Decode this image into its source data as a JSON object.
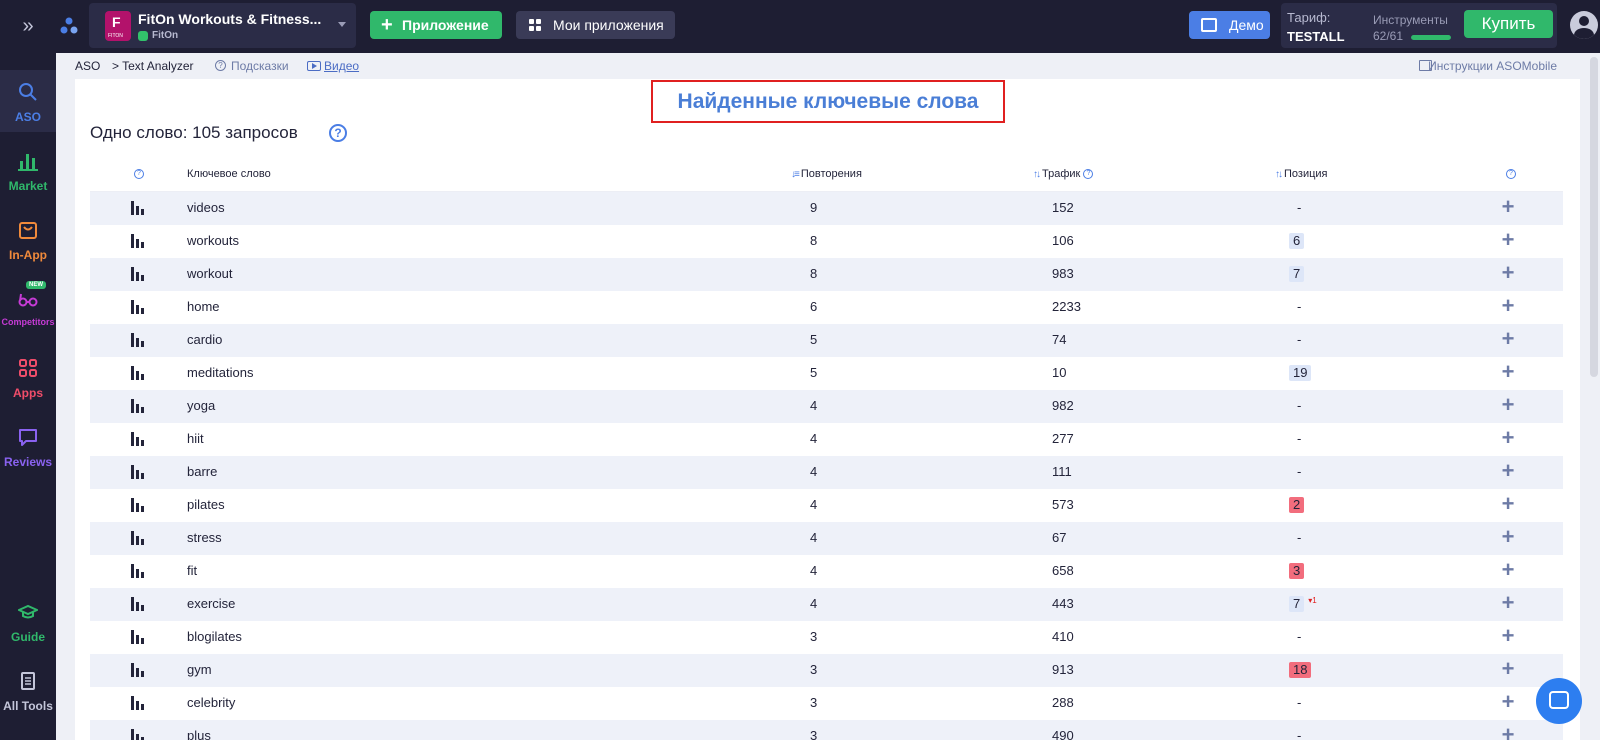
{
  "topbar": {
    "app_title": "FitOn Workouts & Fitness...",
    "app_developer": "FitOn",
    "app_icon_text": "F",
    "app_icon_sub": "FITON",
    "add_app_label": "Приложение",
    "my_apps_label": "Мои приложения",
    "demo_label": "Демо",
    "tariff_label": "Тариф:",
    "tariff_value": "TESTALL",
    "tools_label": "Инструменты",
    "tools_count": "62/61",
    "tools_progress_fraction": 1.0,
    "buy_label": "Купить"
  },
  "sidebar": {
    "items": [
      {
        "label": "ASO",
        "color": "#4b7ee5",
        "icon": "search-icon"
      },
      {
        "label": "Market",
        "color": "#30b86b",
        "icon": "bar-chart-icon"
      },
      {
        "label": "In-App",
        "color": "#f08a3b",
        "icon": "shopping-bag-icon"
      },
      {
        "label": "Competitors",
        "color": "#c63bd6",
        "icon": "glasses-icon",
        "badge": "NEW"
      },
      {
        "label": "Apps",
        "color": "#f04d6a",
        "icon": "apps-grid-icon"
      },
      {
        "label": "Reviews",
        "color": "#8a62f0",
        "icon": "chat-bubble-icon"
      },
      {
        "label": "Guide",
        "color": "#30b86b",
        "icon": "graduation-cap-icon"
      },
      {
        "label": "All Tools",
        "color": "#c4c6da",
        "icon": "document-icon"
      }
    ]
  },
  "breadcrumb": {
    "root": "ASO",
    "current": "> Text Analyzer",
    "hints": "Подсказки",
    "video": "Видео",
    "instructions": "Инструкции ASOMobile"
  },
  "main": {
    "found_title": "Найденные ключевые слова",
    "subtitle": "Одно слово: 105 запросов",
    "help_symbol": "?"
  },
  "table": {
    "headers": {
      "keyword": "Ключевое слово",
      "repeats": "Повторения",
      "traffic": "Трафик",
      "position": "Позиция"
    },
    "rows": [
      {
        "keyword": "videos",
        "repeats": "9",
        "traffic": "152",
        "position": "-",
        "pos_style": "none"
      },
      {
        "keyword": "workouts",
        "repeats": "8",
        "traffic": "106",
        "position": "6",
        "pos_style": "blue"
      },
      {
        "keyword": "workout",
        "repeats": "8",
        "traffic": "983",
        "position": "7",
        "pos_style": "blue"
      },
      {
        "keyword": "home",
        "repeats": "6",
        "traffic": "2233",
        "position": "-",
        "pos_style": "none"
      },
      {
        "keyword": "cardio",
        "repeats": "5",
        "traffic": "74",
        "position": "-",
        "pos_style": "none"
      },
      {
        "keyword": "meditations",
        "repeats": "5",
        "traffic": "10",
        "position": "19",
        "pos_style": "blue"
      },
      {
        "keyword": "yoga",
        "repeats": "4",
        "traffic": "982",
        "position": "-",
        "pos_style": "none"
      },
      {
        "keyword": "hiit",
        "repeats": "4",
        "traffic": "277",
        "position": "-",
        "pos_style": "none"
      },
      {
        "keyword": "barre",
        "repeats": "4",
        "traffic": "111",
        "position": "-",
        "pos_style": "none"
      },
      {
        "keyword": "pilates",
        "repeats": "4",
        "traffic": "573",
        "position": "2",
        "pos_style": "red"
      },
      {
        "keyword": "stress",
        "repeats": "4",
        "traffic": "67",
        "position": "-",
        "pos_style": "none"
      },
      {
        "keyword": "fit",
        "repeats": "4",
        "traffic": "658",
        "position": "3",
        "pos_style": "red"
      },
      {
        "keyword": "exercise",
        "repeats": "4",
        "traffic": "443",
        "position": "7",
        "pos_style": "blue",
        "delta": "▾1"
      },
      {
        "keyword": "blogilates",
        "repeats": "3",
        "traffic": "410",
        "position": "-",
        "pos_style": "none"
      },
      {
        "keyword": "gym",
        "repeats": "3",
        "traffic": "913",
        "position": "18",
        "pos_style": "red"
      },
      {
        "keyword": "celebrity",
        "repeats": "3",
        "traffic": "288",
        "position": "-",
        "pos_style": "none"
      },
      {
        "keyword": "plus",
        "repeats": "3",
        "traffic": "490",
        "position": "-",
        "pos_style": "none"
      }
    ]
  }
}
